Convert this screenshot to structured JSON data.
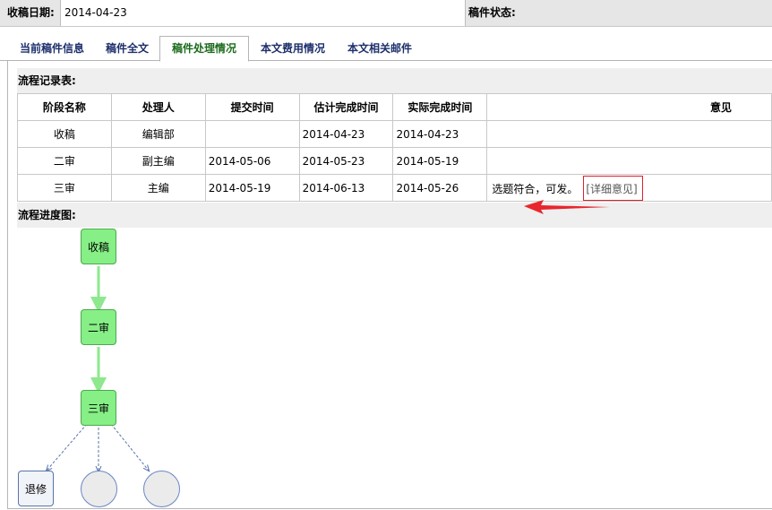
{
  "header": {
    "receive_date_label": "收稿日期:",
    "receive_date_value": "2014-04-23",
    "status_label": "稿件状态:",
    "status_value": ""
  },
  "tabs": [
    {
      "label": "当前稿件信息",
      "active": false
    },
    {
      "label": "稿件全文",
      "active": false
    },
    {
      "label": "稿件处理情况",
      "active": true
    },
    {
      "label": "本文费用情况",
      "active": false
    },
    {
      "label": "本文相关邮件",
      "active": false
    }
  ],
  "record_table": {
    "title": "流程记录表:",
    "columns": [
      "阶段名称",
      "处理人",
      "提交时间",
      "估计完成时间",
      "实际完成时间",
      "意见"
    ],
    "rows": [
      {
        "stage": "收稿",
        "handler": "编辑部",
        "submit": "",
        "estimate": "2014-04-23",
        "actual": "2014-04-23",
        "opinion": "",
        "detail": ""
      },
      {
        "stage": "二审",
        "handler": "副主编",
        "submit": "2014-05-06",
        "estimate": "2014-05-23",
        "actual": "2014-05-19",
        "opinion": "",
        "detail": ""
      },
      {
        "stage": "三审",
        "handler": "主编",
        "submit": "2014-05-19",
        "estimate": "2014-06-13",
        "actual": "2014-05-26",
        "opinion": "选题符合，可发。",
        "detail": "[详细意见]"
      }
    ]
  },
  "progress": {
    "title": "流程进度图:",
    "nodes": [
      {
        "label": "收稿",
        "state": "done"
      },
      {
        "label": "二审",
        "state": "done"
      },
      {
        "label": "三审",
        "state": "done"
      },
      {
        "label": "退修",
        "state": "pending"
      }
    ]
  },
  "colors": {
    "done_node": "#86ef86",
    "done_arrow": "#8ee88e",
    "pending_border": "#6a86c4",
    "annotation_red": "#e8262e",
    "tab_text": "#1c2f6b",
    "active_tab_text": "#1c6b1c"
  }
}
